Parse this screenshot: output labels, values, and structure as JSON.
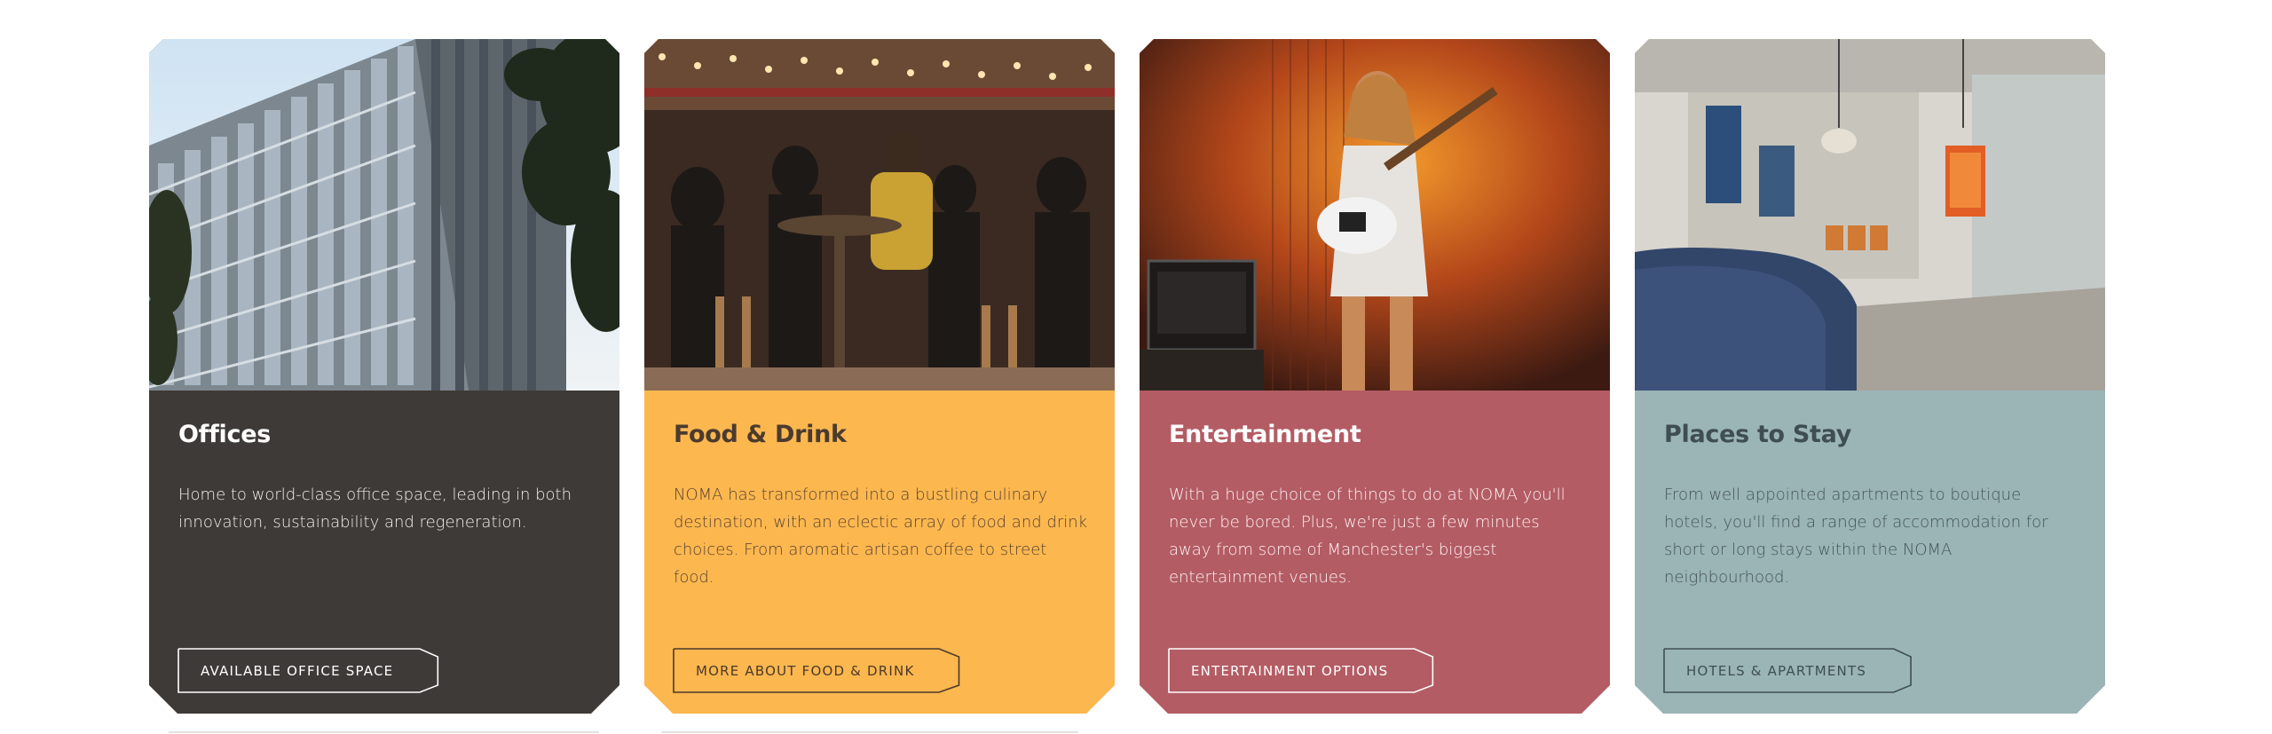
{
  "cards": [
    {
      "title": "Offices",
      "description": "Home to world-class office space, leading in both innovation, sustainability and regeneration.",
      "cta": "Available office space",
      "theme": "dark",
      "image": "office-building-photo"
    },
    {
      "title": "Food & Drink",
      "description": "NOMA has transformed into a bustling culinary destination, with an eclectic array of food and drink choices. From aromatic artisan coffee to street food.",
      "cta": "More about food & drink",
      "theme": "yellow",
      "image": "food-hall-photo"
    },
    {
      "title": "Entertainment",
      "description": "With a huge choice of things to do at NOMA you'll never be bored. Plus, we're just a few minutes away from some of Manchester's biggest entertainment venues.",
      "cta": "Entertainment options",
      "theme": "red",
      "image": "guitarist-photo"
    },
    {
      "title": "Places to Stay",
      "description": "From well appointed apartments to boutique hotels, you'll find a range of accommodation for short or long stays within the NOMA neighbourhood.",
      "cta": "Hotels & apartments",
      "theme": "teal",
      "image": "hotel-lobby-photo"
    }
  ],
  "colors": {
    "dark": "#3e3a37",
    "yellow": "#fcb74f",
    "red": "#b35c64",
    "teal": "#9bb4b6"
  }
}
